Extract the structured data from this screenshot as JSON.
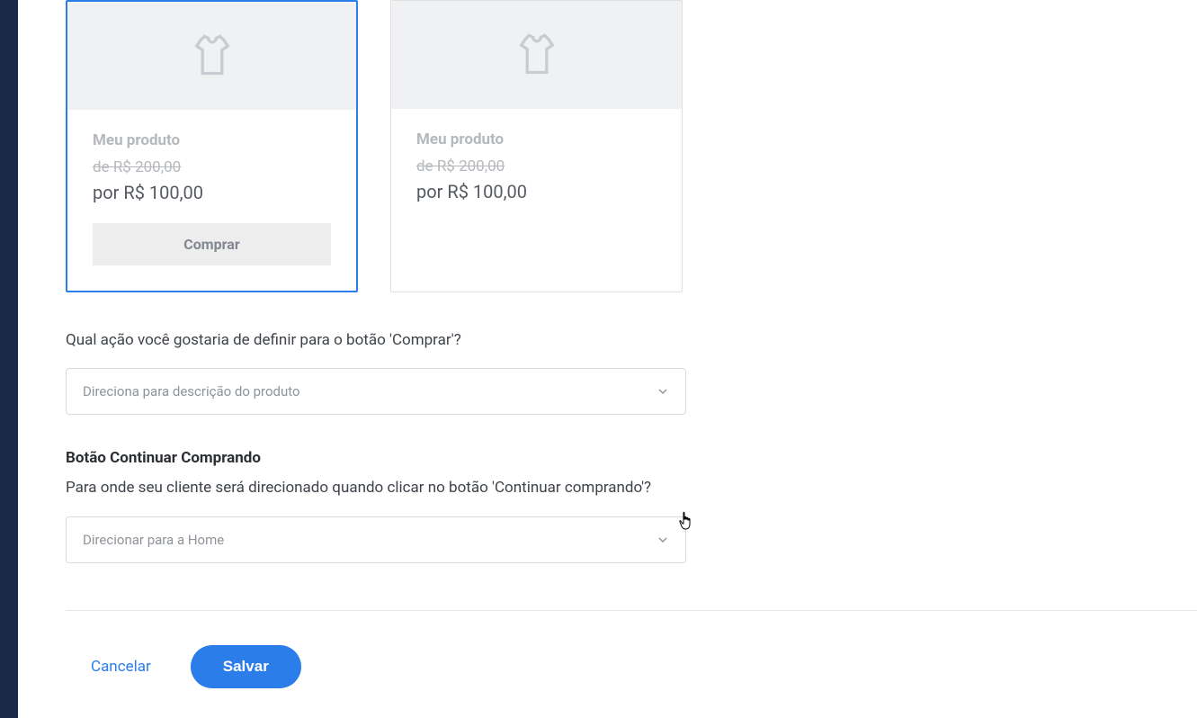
{
  "products": [
    {
      "name": "Meu produto",
      "old_price": "de R$ 200,00",
      "price": "por R$ 100,00",
      "buy_label": "Comprar"
    },
    {
      "name": "Meu produto",
      "old_price": "de R$ 200,00",
      "price": "por R$ 100,00"
    }
  ],
  "form": {
    "action_label": "Qual ação você gostaria de definir para o botão 'Comprar'?",
    "action_selected": "Direciona para descrição do produto",
    "continue_heading": "Botão Continuar Comprando",
    "continue_label": "Para onde seu cliente será direcionado quando clicar no botão 'Continuar comprando'?",
    "continue_selected": "Direcionar para a Home"
  },
  "buttons": {
    "cancel": "Cancelar",
    "save": "Salvar"
  }
}
